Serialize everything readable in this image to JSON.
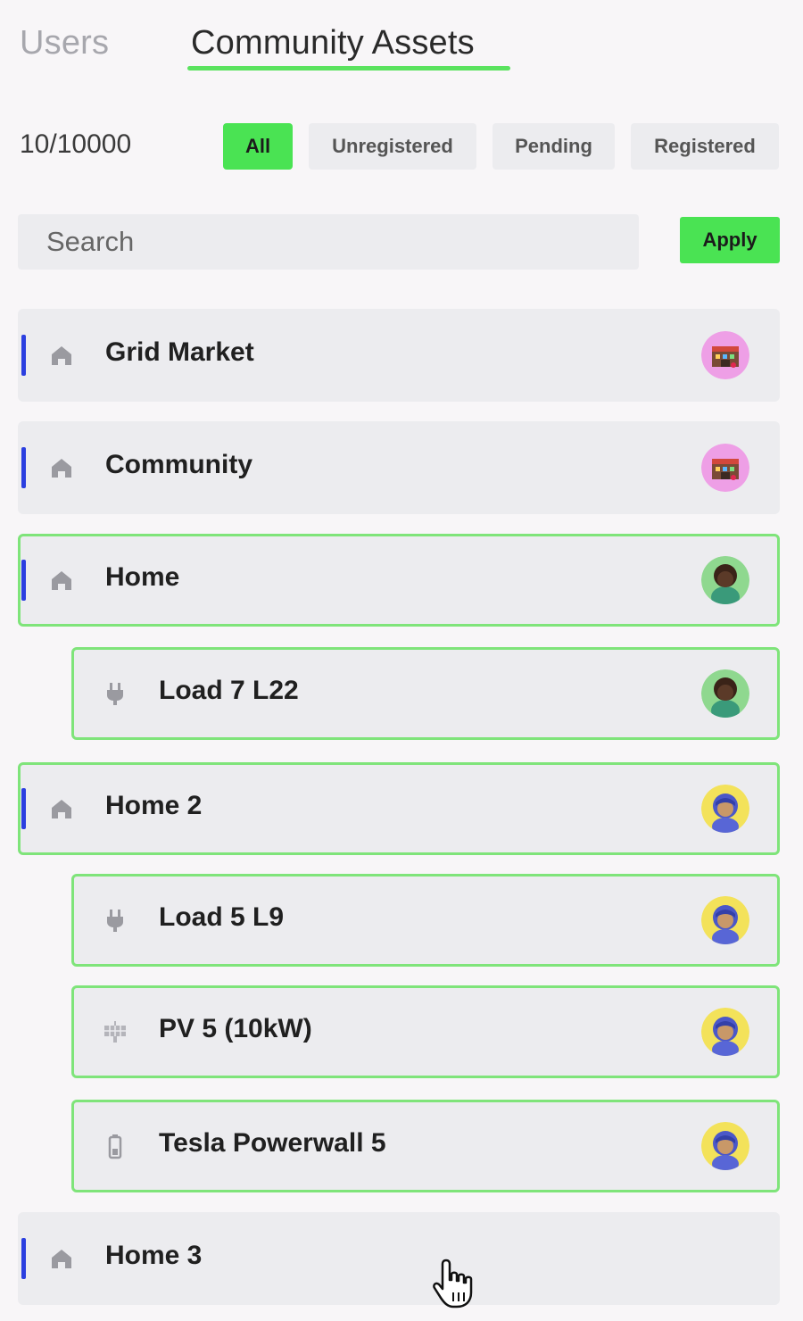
{
  "tabs": {
    "users": "Users",
    "community_assets": "Community Assets"
  },
  "count": "10/10000",
  "filters": [
    "All",
    "Unregistered",
    "Pending",
    "Registered"
  ],
  "search": {
    "placeholder": "Search"
  },
  "apply_label": "Apply",
  "assets": [
    {
      "label": "Grid Market",
      "icon": "home-icon",
      "avatar": "market-avatar"
    },
    {
      "label": "Community",
      "icon": "home-icon",
      "avatar": "market-avatar"
    },
    {
      "label": "Home",
      "icon": "home-icon",
      "avatar": "user-avatar-dark"
    },
    {
      "label": "Load 7 L22",
      "icon": "plug-icon",
      "avatar": "user-avatar-dark"
    },
    {
      "label": "Home 2",
      "icon": "home-icon",
      "avatar": "user-avatar-blue"
    },
    {
      "label": "Load 5 L9",
      "icon": "plug-icon",
      "avatar": "user-avatar-blue"
    },
    {
      "label": "PV 5 (10kW)",
      "icon": "solar-panel-icon",
      "avatar": "user-avatar-blue"
    },
    {
      "label": "Tesla Powerwall 5",
      "icon": "battery-icon",
      "avatar": "user-avatar-blue"
    },
    {
      "label": "Home 3",
      "icon": "home-icon",
      "avatar": ""
    }
  ],
  "colors": {
    "accent": "#4ae353",
    "selected_border": "#7fe47a",
    "tree_bar": "#2b3fe0"
  }
}
